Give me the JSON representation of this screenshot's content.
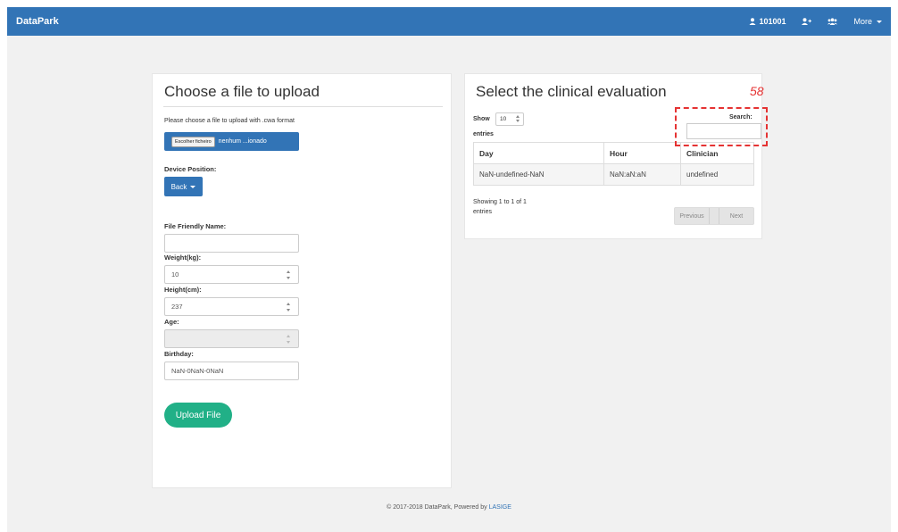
{
  "navbar": {
    "brand": "DataPark",
    "user_id": "101001",
    "more_label": "More"
  },
  "upload_panel": {
    "title": "Choose a file to upload",
    "instruction": "Please choose a file to upload with .cwa format",
    "choose_file_label": "Escolher ficheiro",
    "file_name": "nenhum ...ionado",
    "device_position_label": "Device Position:",
    "device_position_value": "Back",
    "friendly_name_label": "File Friendly Name:",
    "friendly_name_value": "",
    "weight_label": "Weight(kg):",
    "weight_value": "10",
    "height_label": "Height(cm):",
    "height_value": "237",
    "age_label": "Age:",
    "age_value": "",
    "birthday_label": "Birthday:",
    "birthday_value": "NaN-0NaN-0NaN",
    "upload_button": "Upload File"
  },
  "evaluation_panel": {
    "title": "Select the clinical evaluation",
    "show_label": "Show",
    "show_value": "10",
    "entries_label": "entries",
    "search_label": "Search:",
    "columns": [
      "Day",
      "Hour",
      "Clinician"
    ],
    "rows": [
      [
        "NaN-undefined-NaN",
        "NaN:aN:aN",
        "undefined"
      ]
    ],
    "info_line1": "Showing 1 to 1 of 1",
    "info_line2": "entries",
    "previous_label": "Previous",
    "next_label": "Next"
  },
  "annotation": {
    "number": "58",
    "color": "#e53333"
  },
  "footer": {
    "text": "© 2017-2018 DataPark, Powered by ",
    "link": "LASIGE"
  },
  "colors": {
    "primary": "#3274b6",
    "success": "#21b087"
  }
}
